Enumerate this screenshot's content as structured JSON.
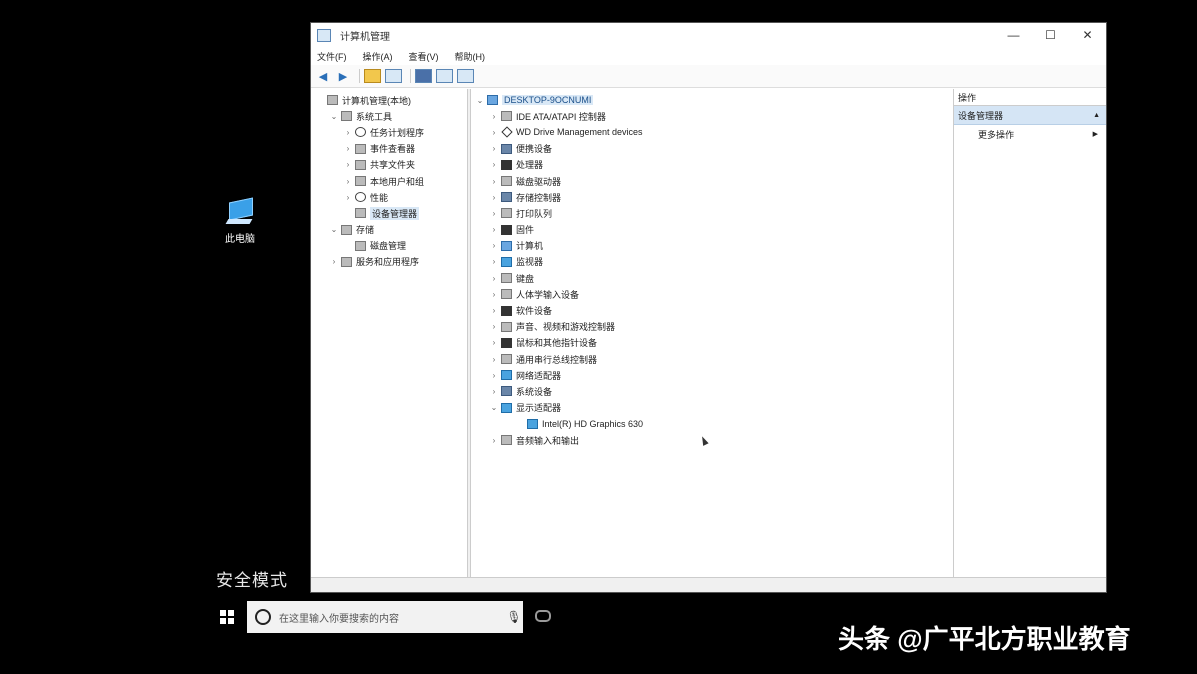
{
  "desktop": {
    "icon_label": "此电脑",
    "safe_mode_text": "安全模式"
  },
  "window": {
    "title": "计算机管理",
    "controls": {
      "minimize": "—",
      "maximize": "☐",
      "close": "✕"
    },
    "menu": [
      "文件(F)",
      "操作(A)",
      "查看(V)",
      "帮助(H)"
    ]
  },
  "left_tree": [
    {
      "label": "计算机管理(本地)",
      "level": 0,
      "expand": "",
      "icon": "gray"
    },
    {
      "label": "系统工具",
      "level": 1,
      "expand": "⌄",
      "icon": "gray"
    },
    {
      "label": "任务计划程序",
      "level": 2,
      "expand": "›",
      "icon": "clock"
    },
    {
      "label": "事件查看器",
      "level": 2,
      "expand": "›",
      "icon": "gray"
    },
    {
      "label": "共享文件夹",
      "level": 2,
      "expand": "›",
      "icon": "gray"
    },
    {
      "label": "本地用户和组",
      "level": 2,
      "expand": "›",
      "icon": "gray"
    },
    {
      "label": "性能",
      "level": 2,
      "expand": "›",
      "icon": "clock"
    },
    {
      "label": "设备管理器",
      "level": 2,
      "expand": "",
      "icon": "gray",
      "selected": true
    },
    {
      "label": "存储",
      "level": 1,
      "expand": "⌄",
      "icon": "gray"
    },
    {
      "label": "磁盘管理",
      "level": 2,
      "expand": "",
      "icon": "gray"
    },
    {
      "label": "服务和应用程序",
      "level": 1,
      "expand": "›",
      "icon": "gray"
    }
  ],
  "device_tree": {
    "root": "DESKTOP-9OCNUMI",
    "items": [
      {
        "label": "IDE ATA/ATAPI 控制器",
        "icon": "gray"
      },
      {
        "label": "WD Drive Management devices",
        "icon": "diamond"
      },
      {
        "label": "便携设备",
        "icon": "dev"
      },
      {
        "label": "处理器",
        "icon": "dark"
      },
      {
        "label": "磁盘驱动器",
        "icon": "gray"
      },
      {
        "label": "存储控制器",
        "icon": "dev"
      },
      {
        "label": "打印队列",
        "icon": "gray"
      },
      {
        "label": "固件",
        "icon": "dark"
      },
      {
        "label": "计算机",
        "icon": "comp"
      },
      {
        "label": "监视器",
        "icon": "blue"
      },
      {
        "label": "键盘",
        "icon": "gray"
      },
      {
        "label": "人体学输入设备",
        "icon": "gray"
      },
      {
        "label": "软件设备",
        "icon": "dark"
      },
      {
        "label": "声音、视频和游戏控制器",
        "icon": "gray"
      },
      {
        "label": "鼠标和其他指针设备",
        "icon": "dark"
      },
      {
        "label": "通用串行总线控制器",
        "icon": "gray"
      },
      {
        "label": "网络适配器",
        "icon": "blue"
      },
      {
        "label": "系统设备",
        "icon": "dev"
      },
      {
        "label": "显示适配器",
        "icon": "blue",
        "expanded": true
      },
      {
        "label": "Intel(R) HD Graphics 630",
        "icon": "blue",
        "child": true
      },
      {
        "label": "音频输入和输出",
        "icon": "gray"
      }
    ]
  },
  "actions": {
    "header": "操作",
    "section": "设备管理器",
    "more": "更多操作"
  },
  "taskbar": {
    "search_placeholder": "在这里输入你要搜索的内容"
  },
  "watermark": "头条 @广平北方职业教育"
}
